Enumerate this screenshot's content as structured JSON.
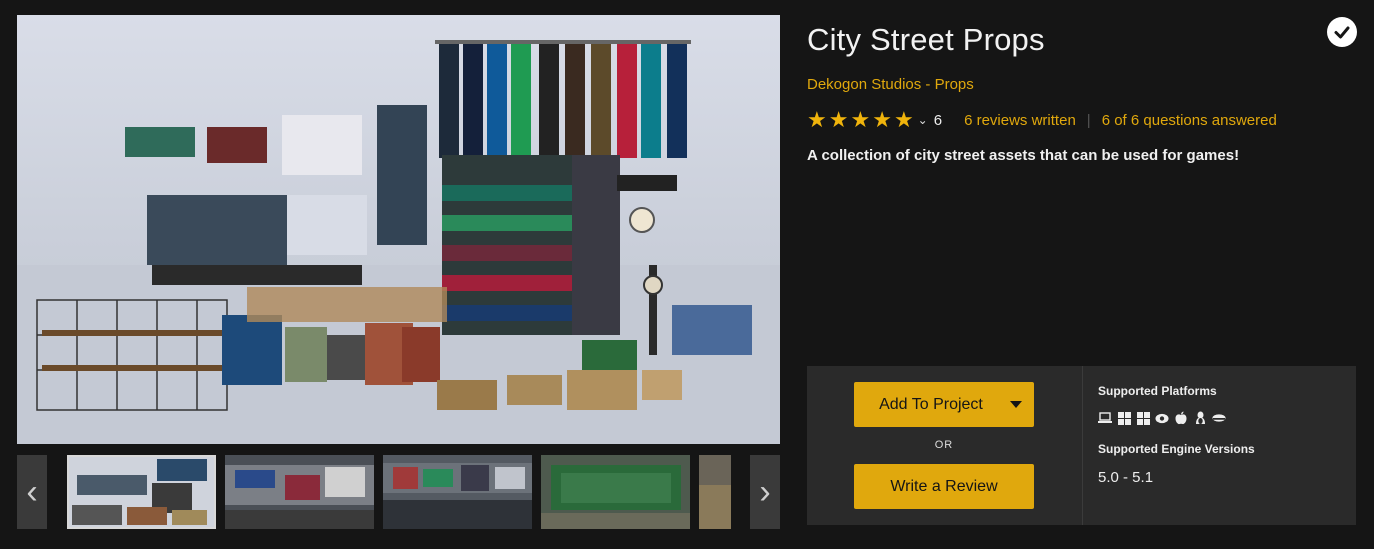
{
  "product": {
    "title": "City Street Props",
    "seller": "Dekogon Studios",
    "separator": "-",
    "category": "Props",
    "description": "A collection of city street assets that can be used for games!"
  },
  "rating": {
    "stars": 5,
    "max_stars": 5,
    "count": "6",
    "reviews_link": "6 reviews written",
    "questions_link": "6 of 6 questions answered",
    "separator": "|"
  },
  "gallery": {
    "thumbnail_count": 5,
    "selected_index": 0
  },
  "actions": {
    "add_label": "Add To Project",
    "or_label": "OR",
    "review_label": "Write a Review"
  },
  "specs": {
    "platforms_heading": "Supported Platforms",
    "platform_icons": [
      "laptop-icon",
      "windows-icon",
      "windows-icon",
      "vr-icon",
      "apple-icon",
      "linux-icon",
      "html5-icon"
    ],
    "engines_heading": "Supported Engine Versions",
    "engine_versions": "5.0 - 5.1"
  },
  "colors": {
    "accent": "#e0a80d",
    "background": "#151515",
    "panel": "#2a2a2a"
  }
}
